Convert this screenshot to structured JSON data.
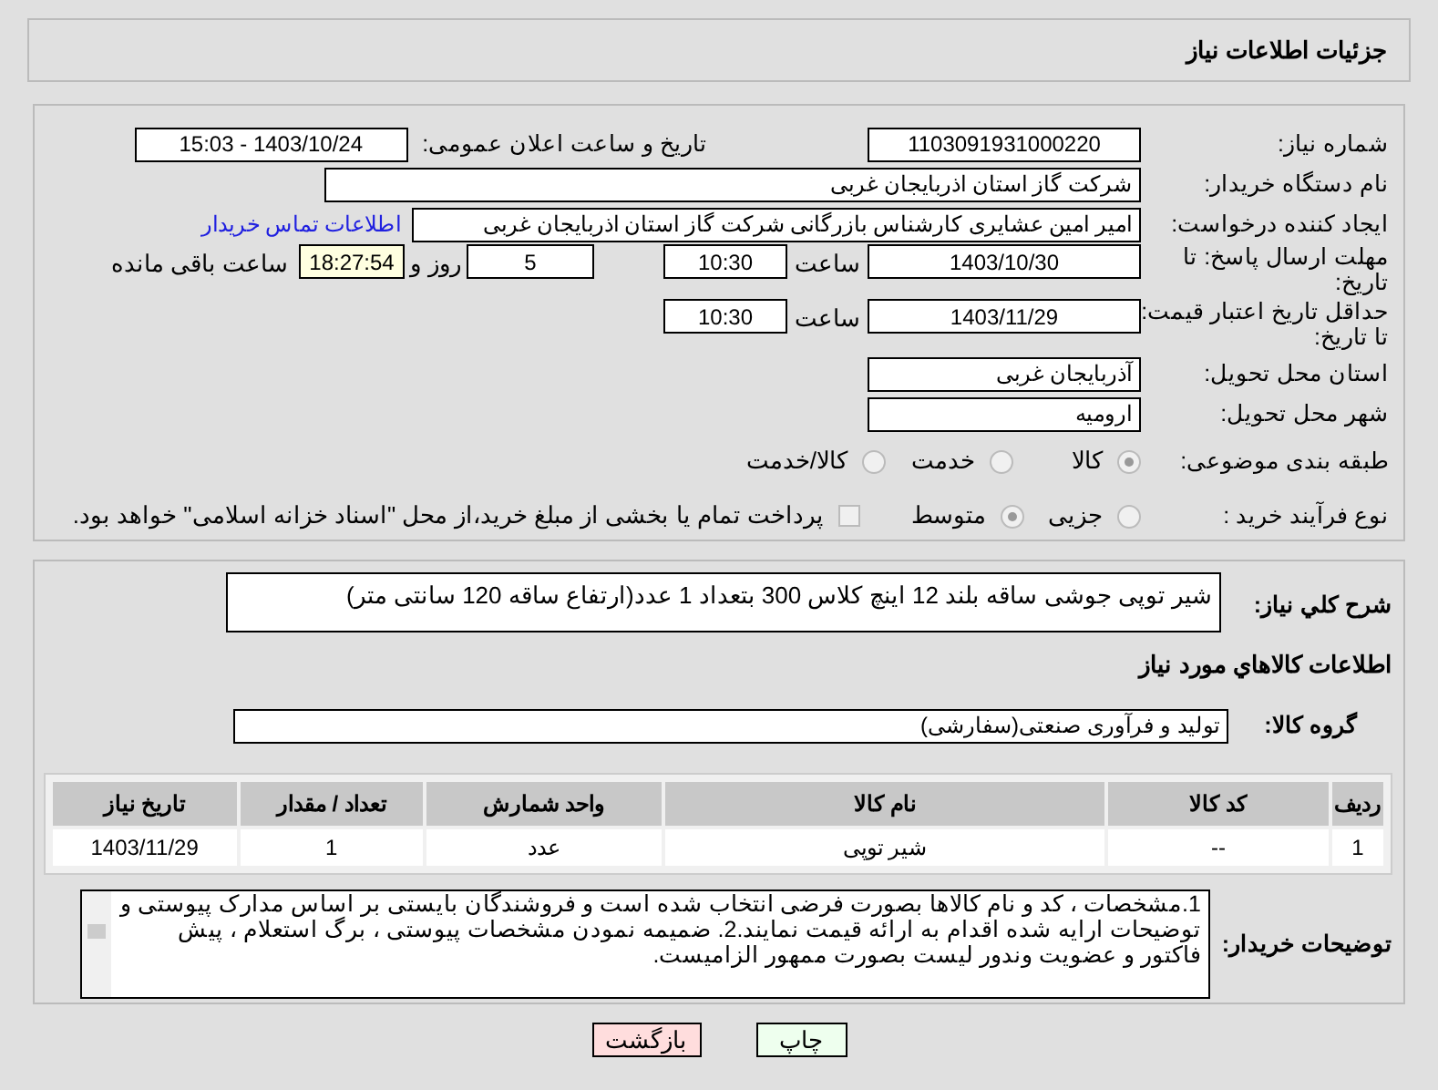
{
  "header": {
    "title": "جزئیات اطلاعات نیاز"
  },
  "need_number": {
    "label": "شماره نیاز:",
    "value": "1103091931000220"
  },
  "announce": {
    "label": "تاریخ و ساعت اعلان عمومی:",
    "value": "1403/10/24 - 15:03"
  },
  "buyer": {
    "label": "نام دستگاه خریدار:",
    "value": "شرکت گاز استان اذربایجان غربی"
  },
  "requester": {
    "label": "ایجاد کننده درخواست:",
    "value": "امیر امین عشایری کارشناس بازرگانی شرکت گاز استان اذربایجان غربی",
    "link": "اطلاعات تماس خریدار"
  },
  "deadline": {
    "label": "مهلت ارسال پاسخ: تا تاریخ:",
    "date": "1403/10/30",
    "time_label": "ساعت",
    "time": "10:30",
    "days": "5",
    "days_label": "روز و",
    "remaining": "18:27:54",
    "remaining_label": "ساعت باقی مانده"
  },
  "validity": {
    "label": "حداقل تاریخ اعتبار قیمت: تا تاریخ:",
    "date": "1403/11/29",
    "time_label": "ساعت",
    "time": "10:30"
  },
  "province": {
    "label": "استان محل تحویل:",
    "value": "آذربایجان غربی"
  },
  "city": {
    "label": "شهر محل تحویل:",
    "value": "ارومیه"
  },
  "category": {
    "label": "طبقه بندی موضوعی:",
    "options": [
      {
        "label": "کالا",
        "selected": true
      },
      {
        "label": "خدمت",
        "selected": false
      },
      {
        "label": "کالا/خدمت",
        "selected": false
      }
    ]
  },
  "process": {
    "label": "نوع فرآیند خرید :",
    "options": [
      {
        "label": "جزیی",
        "selected": false
      },
      {
        "label": "متوسط",
        "selected": true
      }
    ],
    "checkbox": {
      "label": "پرداخت تمام یا بخشی از مبلغ خرید،از محل \"اسناد خزانه اسلامی\" خواهد بود.",
      "checked": false
    }
  },
  "description": {
    "label": "شرح کلي نياز:",
    "value": "شیر توپی جوشی ساقه بلند 12 اینچ کلاس 300 بتعداد 1 عدد(ارتفاع ساقه 120 سانتی متر)"
  },
  "goods_title": "اطلاعات کالاهاي مورد نياز",
  "group": {
    "label": "گروه کالا:",
    "value": "تولید و فرآوری صنعتی(سفارشی)"
  },
  "table": {
    "columns": [
      "ردیف",
      "کد کالا",
      "نام کالا",
      "واحد شمارش",
      "تعداد / مقدار",
      "تاریخ نیاز"
    ],
    "rows": [
      [
        "1",
        "--",
        "شیر توپی",
        "عدد",
        "1",
        "1403/11/29"
      ]
    ]
  },
  "notes": {
    "label": "توضیحات خریدار:",
    "value": "1.مشخصات ، کد و نام کالاها بصورت فرضی انتخاب شده است و فروشندگان بایستی بر اساس مدارک پیوستی و توضیحات ارایه شده اقدام به ارائه قیمت نمایند.2. ضمیمه نمودن مشخصات پیوستی ، برگ استعلام ، پیش فاکتور و عضویت وندور لیست بصورت ممهور الزامیست."
  },
  "buttons": [
    {
      "label": "چاپ",
      "kind": "print"
    },
    {
      "label": "بازگشت",
      "kind": "back"
    }
  ]
}
